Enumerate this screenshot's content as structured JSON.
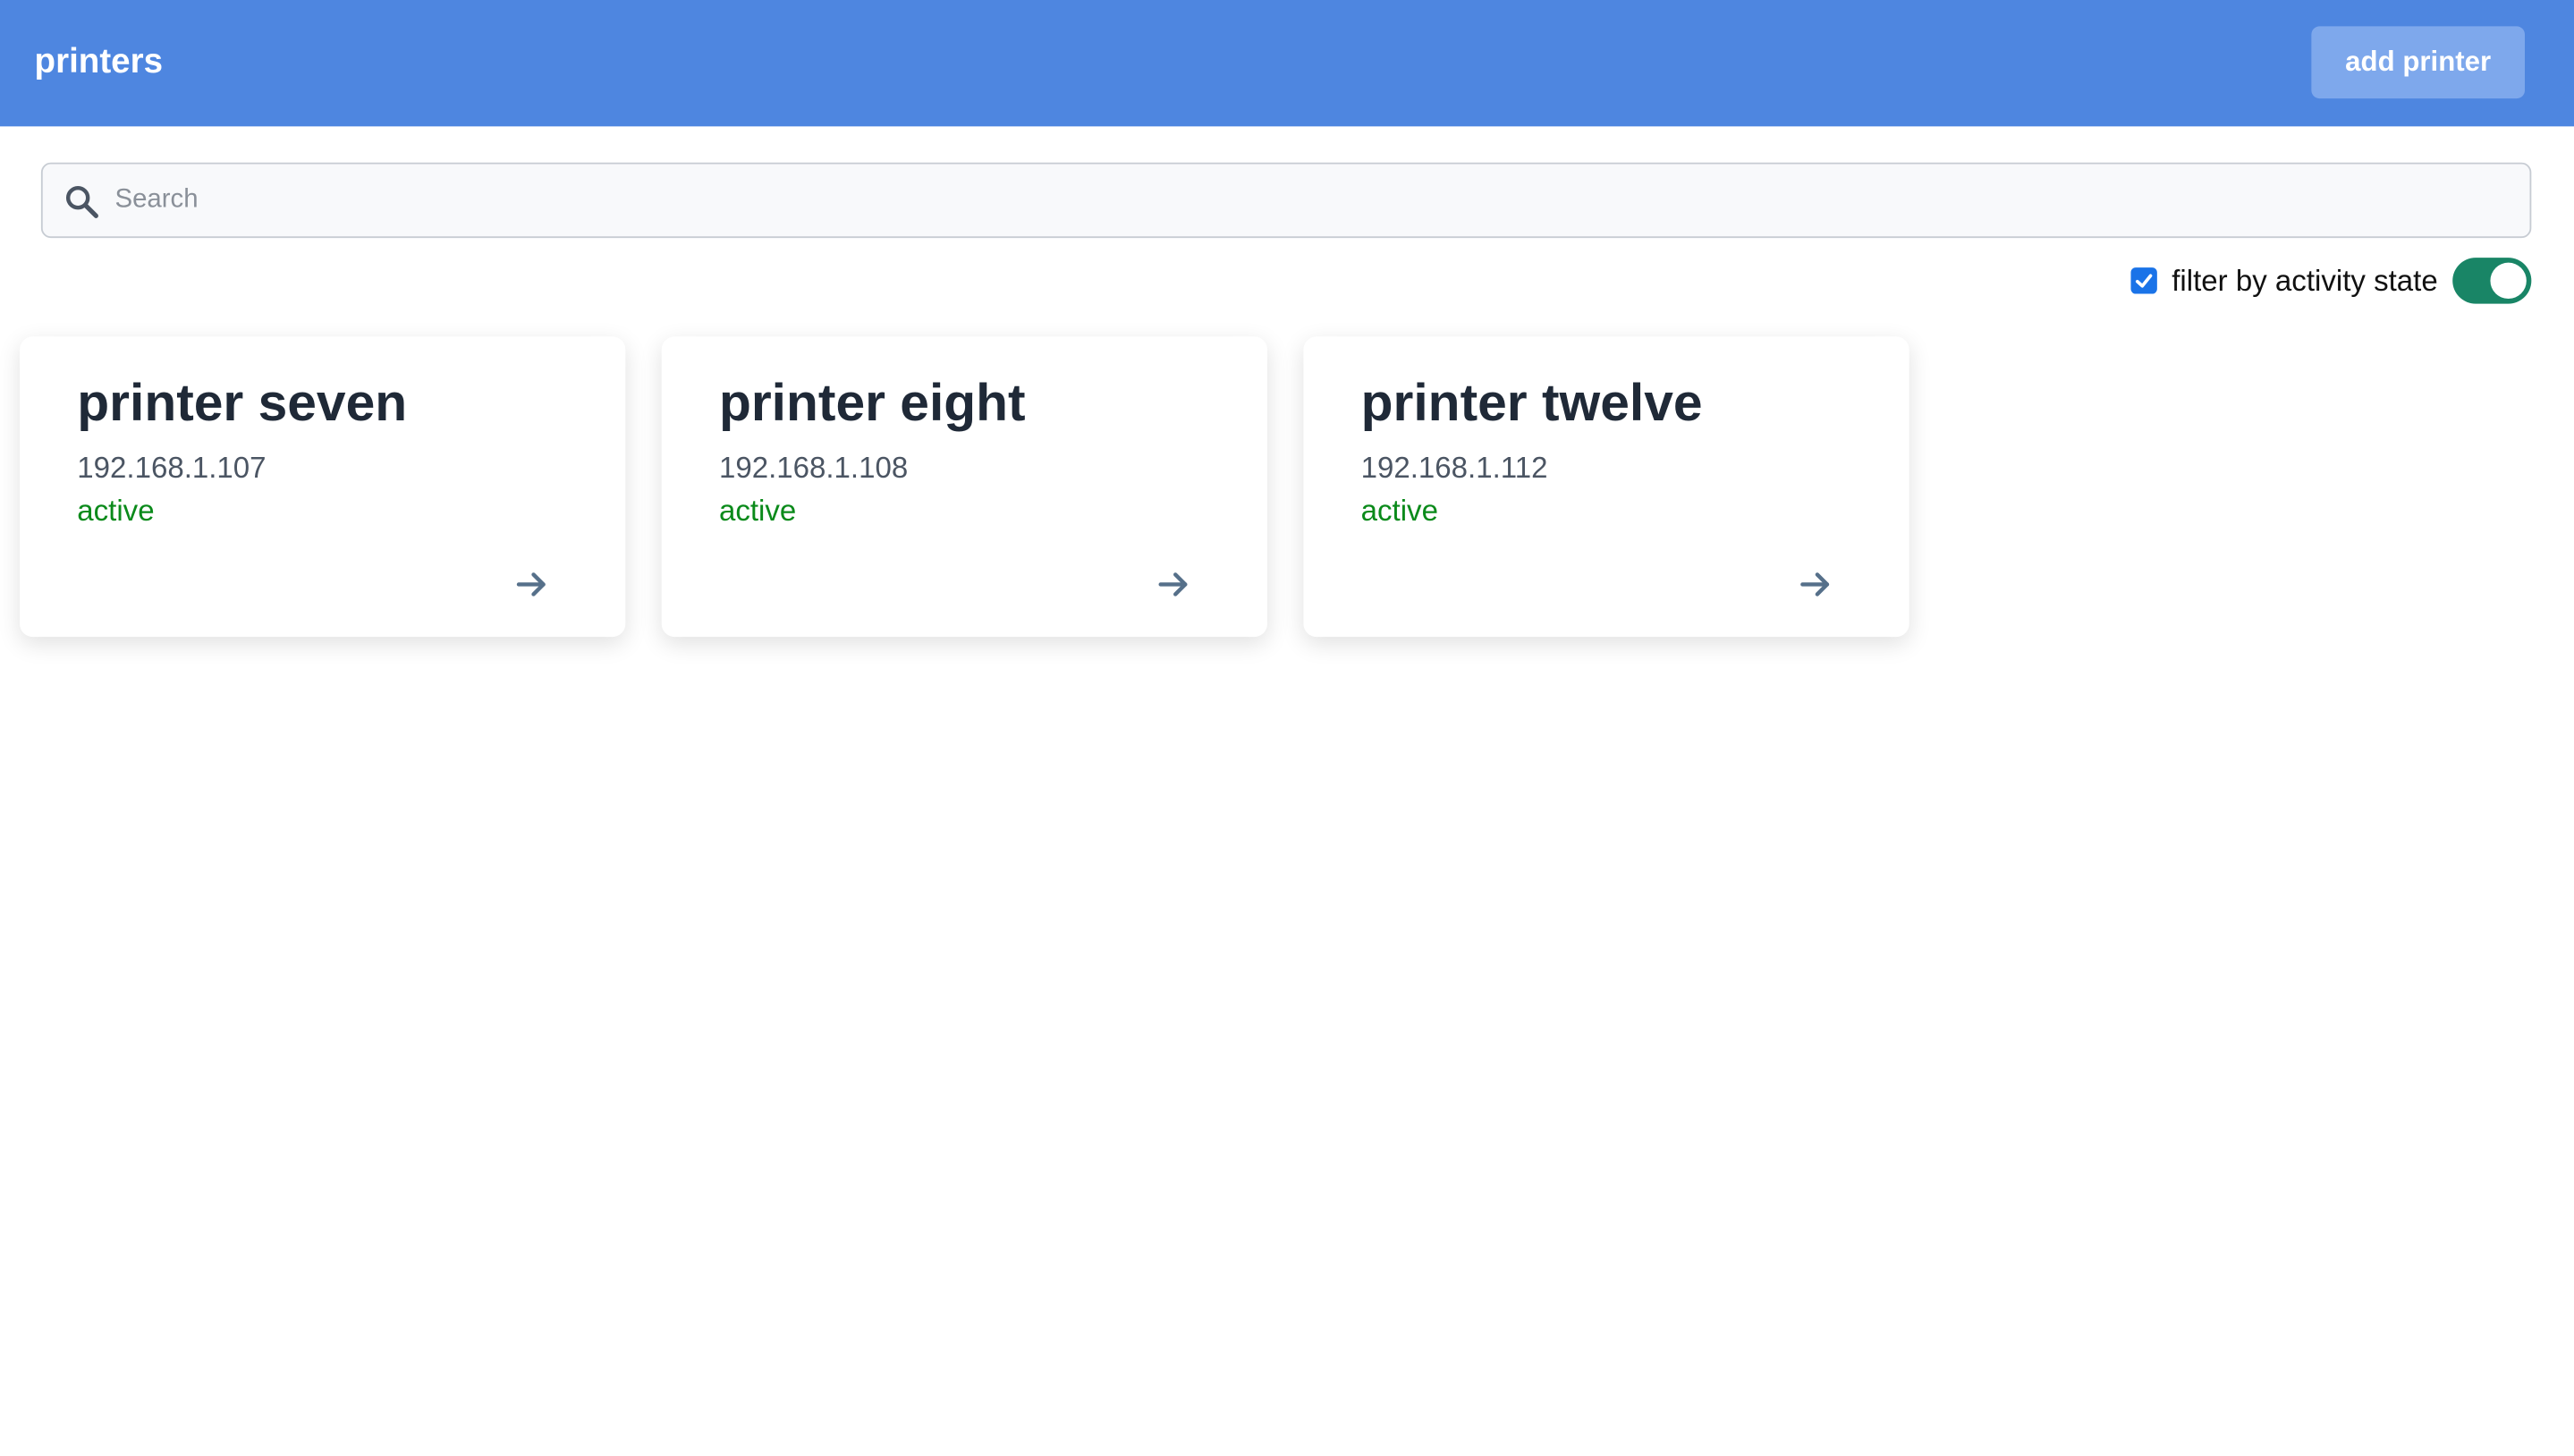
{
  "header": {
    "title": "printers",
    "add_button_label": "add printer"
  },
  "search": {
    "placeholder": "Search",
    "value": ""
  },
  "filter": {
    "label": "filter by activity state",
    "checked": true,
    "toggle_on": true
  },
  "printers": [
    {
      "name": "printer seven",
      "ip": "192.168.1.107",
      "status": "active"
    },
    {
      "name": "printer eight",
      "ip": "192.168.1.108",
      "status": "active"
    },
    {
      "name": "printer twelve",
      "ip": "192.168.1.112",
      "status": "active"
    }
  ],
  "colors": {
    "header_bg": "#4e86e0",
    "button_bg": "#7ea8ec",
    "status_active": "#0a8a1a",
    "toggle_on": "#198566",
    "checkbox": "#1a73e8"
  },
  "icons": {
    "search": "search-icon",
    "card_action": "arrow-right-icon",
    "checkbox": "check-icon"
  }
}
